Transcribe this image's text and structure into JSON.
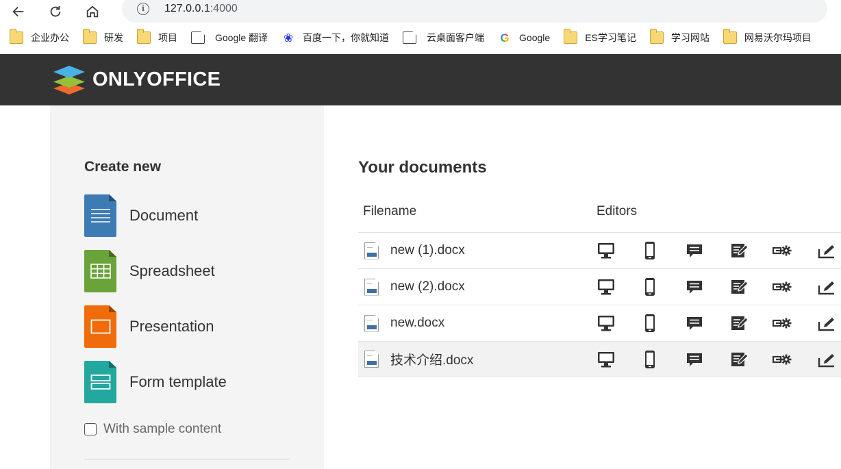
{
  "browser": {
    "url_host": "127.0.0.1",
    "url_port": ":4000"
  },
  "bookmarks": [
    {
      "label": "企业办公",
      "icon": "folder-icon"
    },
    {
      "label": "研发",
      "icon": "folder-icon"
    },
    {
      "label": "项目",
      "icon": "folder-icon"
    },
    {
      "label": "Google 翻译",
      "icon": "page-icon"
    },
    {
      "label": "百度一下，你就知道",
      "icon": "baidu-icon"
    },
    {
      "label": "云桌面客户端",
      "icon": "page-icon"
    },
    {
      "label": "Google",
      "icon": "google-icon"
    },
    {
      "label": "ES学习笔记",
      "icon": "folder-icon"
    },
    {
      "label": "学习网站",
      "icon": "folder-icon"
    },
    {
      "label": "网易沃尔玛项目",
      "icon": "folder-icon"
    }
  ],
  "header": {
    "logo_text": "ONLYOFFICE"
  },
  "create": {
    "title": "Create new",
    "items": [
      {
        "label": "Document",
        "color": "#3d7bb5"
      },
      {
        "label": "Spreadsheet",
        "color": "#6aa339"
      },
      {
        "label": "Presentation",
        "color": "#f06c0a"
      },
      {
        "label": "Form template",
        "color": "#22a89e"
      }
    ],
    "sample_label": "With sample content"
  },
  "documents": {
    "title": "Your documents",
    "col_filename": "Filename",
    "col_editors": "Editors",
    "files": [
      {
        "name": "new (1).docx"
      },
      {
        "name": "new (2).docx"
      },
      {
        "name": "new.docx"
      },
      {
        "name": "技术介绍.docx"
      }
    ],
    "editor_icons": [
      "desktop-icon",
      "mobile-icon",
      "comment-icon",
      "review-icon",
      "embedded-settings-icon",
      "fill-form-icon"
    ]
  }
}
